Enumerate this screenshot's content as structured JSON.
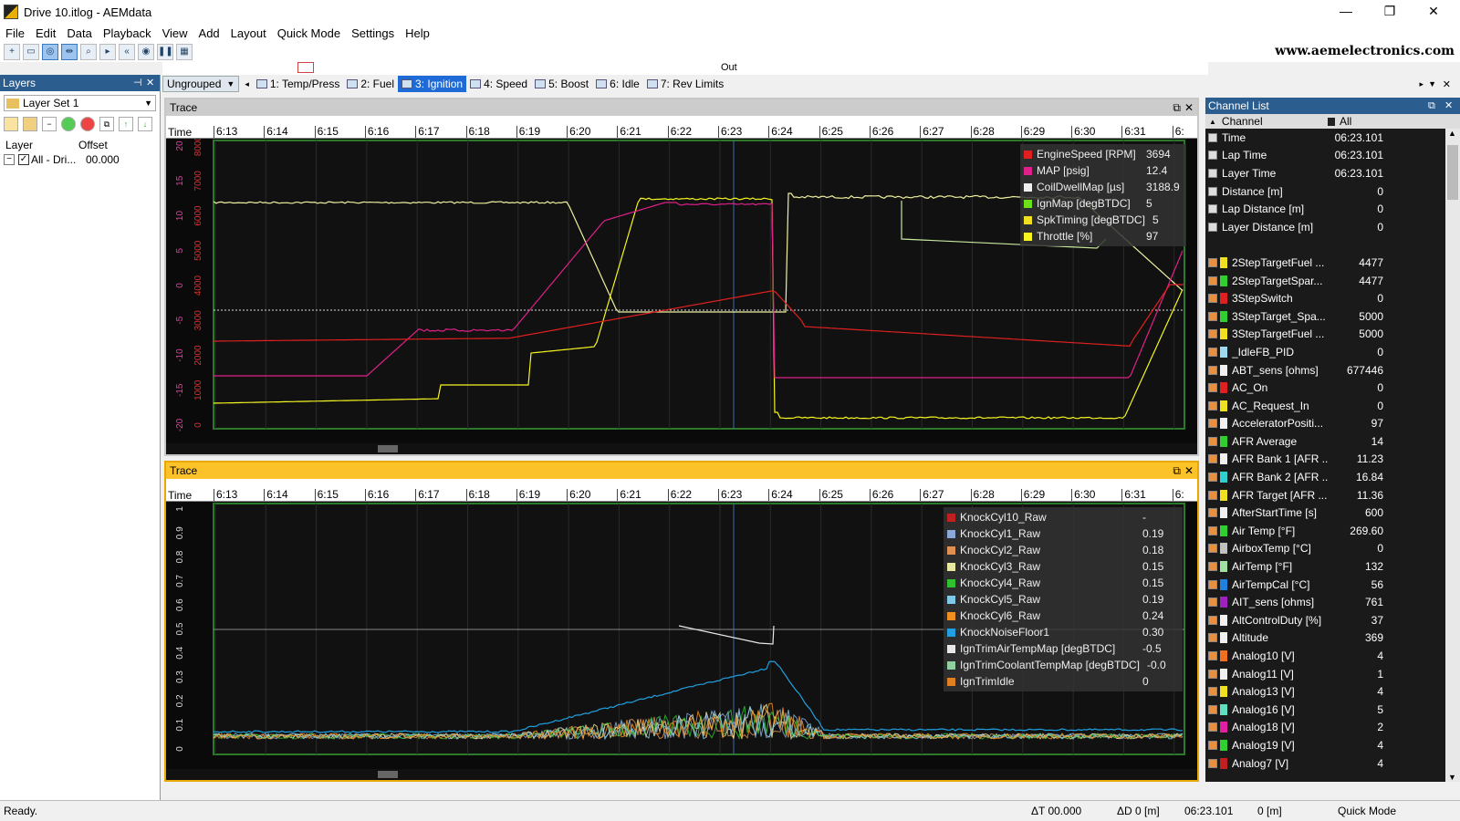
{
  "window": {
    "title": "Drive 10.itlog - AEMdata",
    "minimize": "—",
    "maximize": "❐",
    "close": "✕"
  },
  "menu": [
    "File",
    "Edit",
    "Data",
    "Playback",
    "View",
    "Add",
    "Layout",
    "Quick Mode",
    "Settings",
    "Help"
  ],
  "brand": "www.aemelectronics.com",
  "ruler": {
    "out_label": "Out"
  },
  "layers": {
    "title": "Layers",
    "layer_set": "Layer Set 1",
    "col_layer": "Layer",
    "col_offset": "Offset",
    "row_name": "All - Dri...",
    "row_offset": "00.000"
  },
  "tabs": {
    "group": "Ungrouped",
    "items": [
      "1: Temp/Press",
      "2: Fuel",
      "3: Ignition",
      "4: Speed",
      "5: Boost",
      "6: Idle",
      "7: Rev Limits"
    ],
    "active_index": 2
  },
  "time_axis": {
    "label": "Time",
    "ticks": [
      "6:13",
      "6:14",
      "6:15",
      "6:16",
      "6:17",
      "6:18",
      "6:19",
      "6:20",
      "6:21",
      "6:22",
      "6:23",
      "6:24",
      "6:25",
      "6:26",
      "6:27",
      "6:28",
      "6:29",
      "6:30",
      "6:31",
      "6:"
    ]
  },
  "trace1": {
    "title": "Trace",
    "rpm_ticks": [
      "8000",
      "7000",
      "6000",
      "5000",
      "4000",
      "3000",
      "2000",
      "1000",
      "0"
    ],
    "map_ticks": [
      "20",
      "15",
      "10",
      "5",
      "0",
      "-5",
      "-10",
      "-15",
      "-20"
    ],
    "legend": [
      {
        "name": "EngineSpeed [RPM]",
        "value": "3694",
        "color": "#e02020"
      },
      {
        "name": "MAP [psig]",
        "value": "12.4",
        "color": "#e0208a"
      },
      {
        "name": "CoilDwellMap [µs]",
        "value": "3188.9",
        "color": "#f0f0f0"
      },
      {
        "name": "IgnMap [degBTDC]",
        "value": "5",
        "color": "#6ee01a"
      },
      {
        "name": "SpkTiming [degBTDC]",
        "value": "5",
        "color": "#f0e020"
      },
      {
        "name": "Throttle [%]",
        "value": "97",
        "color": "#f5f520"
      }
    ]
  },
  "trace2": {
    "title": "Trace",
    "ticks": [
      "1",
      "0.9",
      "0.8",
      "0.7",
      "0.6",
      "0.5",
      "0.4",
      "0.3",
      "0.2",
      "0.1",
      "0"
    ],
    "legend": [
      {
        "name": "KnockCyl10_Raw",
        "value": "-",
        "color": "#c02020"
      },
      {
        "name": "KnockCyl1_Raw",
        "value": "0.19",
        "color": "#8aa8d8"
      },
      {
        "name": "KnockCyl2_Raw",
        "value": "0.18",
        "color": "#e09050"
      },
      {
        "name": "KnockCyl3_Raw",
        "value": "0.15",
        "color": "#e8e8a0"
      },
      {
        "name": "KnockCyl4_Raw",
        "value": "0.15",
        "color": "#30c030"
      },
      {
        "name": "KnockCyl5_Raw",
        "value": "0.19",
        "color": "#80c8e8"
      },
      {
        "name": "KnockCyl6_Raw",
        "value": "0.24",
        "color": "#f09020"
      },
      {
        "name": "KnockNoiseFloor1",
        "value": "0.30",
        "color": "#20a0e0"
      },
      {
        "name": "IgnTrimAirTempMap [degBTDC]",
        "value": "-0.5",
        "color": "#e8e8e8"
      },
      {
        "name": "IgnTrimCoolantTempMap [degBTDC]",
        "value": "-0.0",
        "color": "#90d0a0"
      },
      {
        "name": "IgnTrimIdle",
        "value": "0",
        "color": "#e08020"
      }
    ]
  },
  "channel_list": {
    "title": "Channel List",
    "col_channel": "Channel",
    "col_all": "All",
    "rows": [
      {
        "name": "Time",
        "value": "06:23.101",
        "color": ""
      },
      {
        "name": "Lap Time",
        "value": "06:23.101",
        "color": ""
      },
      {
        "name": "Layer Time",
        "value": "06:23.101",
        "color": ""
      },
      {
        "name": "Distance [m]",
        "value": "0",
        "color": ""
      },
      {
        "name": "Lap Distance [m]",
        "value": "0",
        "color": ""
      },
      {
        "name": "Layer Distance [m]",
        "value": "0",
        "color": ""
      },
      {
        "name": "",
        "value": "",
        "color": ""
      },
      {
        "name": "2StepTargetFuel ...",
        "value": "4477",
        "color": "#f0e020"
      },
      {
        "name": "2StepTargetSpar...",
        "value": "4477",
        "color": "#30d030"
      },
      {
        "name": "3StepSwitch",
        "value": "0",
        "color": "#e02020"
      },
      {
        "name": "3StepTarget_Spa...",
        "value": "5000",
        "color": "#30d030"
      },
      {
        "name": "3StepTargetFuel ...",
        "value": "5000",
        "color": "#f0e020"
      },
      {
        "name": "_IdleFB_PID",
        "value": "0",
        "color": "#a0d8f0"
      },
      {
        "name": "ABT_sens [ohms]",
        "value": "677446",
        "color": "#f0f0f0"
      },
      {
        "name": "AC_On",
        "value": "0",
        "color": "#e02020"
      },
      {
        "name": "AC_Request_In",
        "value": "0",
        "color": "#f0e020"
      },
      {
        "name": "AcceleratorPositi...",
        "value": "97",
        "color": "#f0f0f0"
      },
      {
        "name": "AFR Average",
        "value": "14",
        "color": "#30d030"
      },
      {
        "name": "AFR Bank 1 [AFR ...",
        "value": "11.23",
        "color": "#f0f0f0"
      },
      {
        "name": "AFR Bank 2 [AFR ...",
        "value": "16.84",
        "color": "#30d0d0"
      },
      {
        "name": "AFR Target [AFR ...",
        "value": "11.36",
        "color": "#f0e020"
      },
      {
        "name": "AfterStartTime [s]",
        "value": "600",
        "color": "#f0f0f0"
      },
      {
        "name": "Air Temp [°F]",
        "value": "269.60",
        "color": "#30d030"
      },
      {
        "name": "AirboxTemp [°C]",
        "value": "0",
        "color": "#c0c0c0"
      },
      {
        "name": "AirTemp [°F]",
        "value": "132",
        "color": "#a0e0a0"
      },
      {
        "name": "AirTempCal [°C]",
        "value": "56",
        "color": "#2080e0"
      },
      {
        "name": "AIT_sens [ohms]",
        "value": "761",
        "color": "#a020c0"
      },
      {
        "name": "AltControlDuty [%]",
        "value": "37",
        "color": "#f0f0f0"
      },
      {
        "name": "Altitude",
        "value": "369",
        "color": "#f0f0f0"
      },
      {
        "name": "Analog10 [V]",
        "value": "4",
        "color": "#f07020"
      },
      {
        "name": "Analog11 [V]",
        "value": "1",
        "color": "#f0f0f0"
      },
      {
        "name": "Analog13 [V]",
        "value": "4",
        "color": "#f0e020"
      },
      {
        "name": "Analog16 [V]",
        "value": "5",
        "color": "#60e0c0"
      },
      {
        "name": "Analog18 [V]",
        "value": "2",
        "color": "#e020a0"
      },
      {
        "name": "Analog19 [V]",
        "value": "4",
        "color": "#30d030"
      },
      {
        "name": "Analog7 [V]",
        "value": "4",
        "color": "#c02020"
      }
    ]
  },
  "status": {
    "ready": "Ready.",
    "delta_t": "ΔT 00.000",
    "delta_d": "ΔD 0 [m]",
    "time": "06:23.101",
    "dist": "0 [m]",
    "mode": "Quick Mode"
  }
}
